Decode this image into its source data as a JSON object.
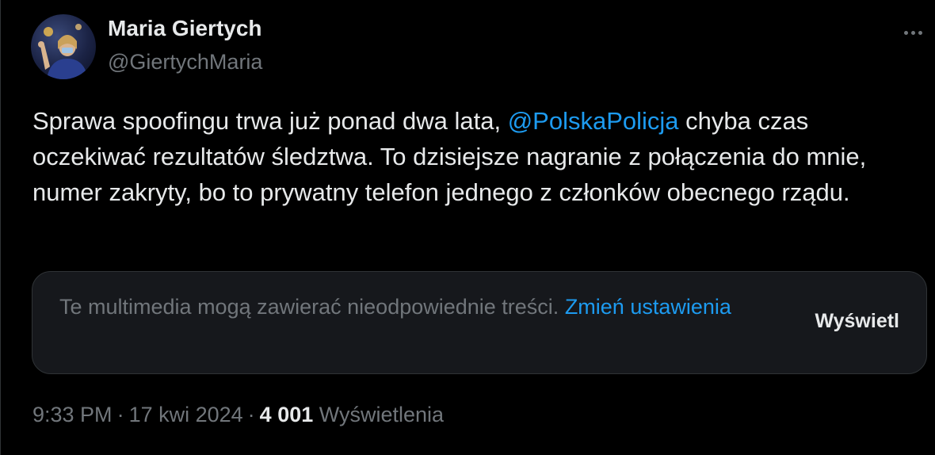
{
  "colors": {
    "background": "#000000",
    "text_primary": "#e7e9ea",
    "text_secondary": "#71767b",
    "accent": "#1d9bf0",
    "card_background": "#16181c",
    "border": "#2f3336"
  },
  "author": {
    "name": "Maria Giertych",
    "handle": "@GiertychMaria",
    "avatar_icon": "profile-photo"
  },
  "more_icon": "ellipsis-icon",
  "tweet": {
    "text_part1": "Sprawa spoofingu trwa już ponad dwa lata, ",
    "mention": "@PolskaPolicja",
    "text_part2": " chyba czas oczekiwać rezultatów śledztwa. To dzisiejsze nagranie z połączenia do mnie, numer zakryty, bo to prywatny telefon jednego z członków obecnego rządu."
  },
  "media_warning": {
    "message": "Te multimedia mogą zawierać nieodpowiednie treści. ",
    "change_settings_link": "Zmień ustawienia",
    "show_button": "Wyświetl"
  },
  "meta": {
    "time": "9:33 PM",
    "separator": "·",
    "date": "17 kwi 2024",
    "views_count": "4 001",
    "views_label": "Wyświetlenia"
  }
}
